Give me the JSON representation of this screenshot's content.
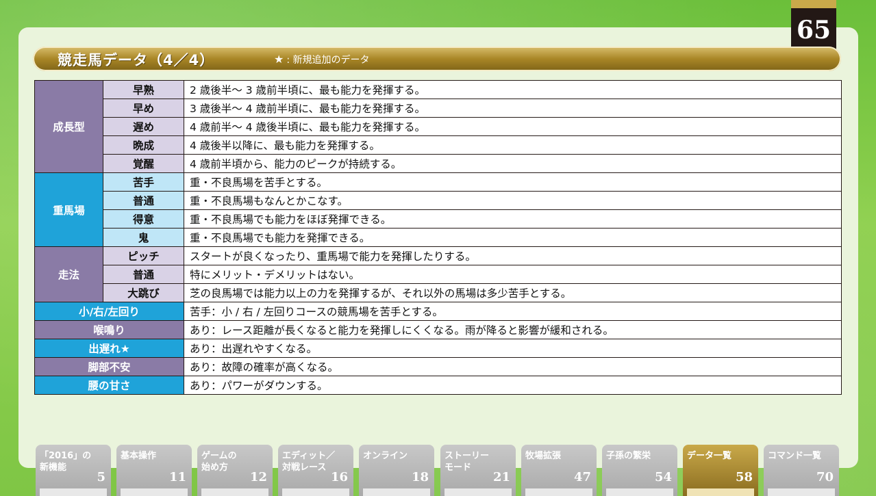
{
  "page_number": "65",
  "header": {
    "title": "競走馬データ（4／4）",
    "legend_mark": "★",
    "legend_text": ": 新規追加のデータ"
  },
  "table": {
    "groups": [
      {
        "category": "成長型",
        "color": "purple",
        "rows": [
          {
            "sub": "早熟",
            "desc": "2 歳後半〜 3 歳前半頃に、最も能力を発揮する。"
          },
          {
            "sub": "早め",
            "desc": "3 歳後半〜 4 歳前半頃に、最も能力を発揮する。"
          },
          {
            "sub": "遅め",
            "desc": "4 歳前半〜 4 歳後半頃に、最も能力を発揮する。"
          },
          {
            "sub": "晩成",
            "desc": "4 歳後半以降に、最も能力を発揮する。"
          },
          {
            "sub": "覚醒",
            "desc": "4 歳前半頃から、能力のピークが持続する。"
          }
        ]
      },
      {
        "category": "重馬場",
        "color": "cyan",
        "rows": [
          {
            "sub": "苦手",
            "desc": "重・不良馬場を苦手とする。"
          },
          {
            "sub": "普通",
            "desc": "重・不良馬場もなんとかこなす。"
          },
          {
            "sub": "得意",
            "desc": "重・不良馬場でも能力をほぼ発揮できる。"
          },
          {
            "sub": "鬼",
            "desc": "重・不良馬場でも能力を発揮できる。"
          }
        ]
      },
      {
        "category": "走法",
        "color": "purple",
        "rows": [
          {
            "sub": "ピッチ",
            "desc": "スタートが良くなったり、重馬場で能力を発揮したりする。"
          },
          {
            "sub": "普通",
            "desc": "特にメリット・デメリットはない。"
          },
          {
            "sub": "大跳び",
            "desc": "芝の良馬場では能力以上の力を発揮するが、それ以外の馬場は多少苦手とする。"
          }
        ]
      }
    ],
    "single_rows": [
      {
        "label": "小/右/左回り",
        "color": "cyan",
        "desc": "苦手：小 / 右 / 左回りコースの競馬場を苦手とする。"
      },
      {
        "label": "喉鳴り",
        "color": "purple",
        "desc": "あり：レース距離が長くなると能力を発揮しにくくなる。雨が降ると影響が緩和される。"
      },
      {
        "label": "出遅れ★",
        "color": "cyan",
        "desc": "あり：出遅れやすくなる。"
      },
      {
        "label": "脚部不安",
        "color": "purple",
        "desc": "あり：故障の確率が高くなる。"
      },
      {
        "label": "腰の甘さ",
        "color": "cyan",
        "desc": "あり：パワーがダウンする。"
      }
    ]
  },
  "nav_tabs": [
    {
      "label": "「2016」の\n新機能",
      "page": "5",
      "active": false
    },
    {
      "label": "基本操作",
      "page": "11",
      "active": false
    },
    {
      "label": "ゲームの\n始め方",
      "page": "12",
      "active": false
    },
    {
      "label": "エディット／\n対戦レース",
      "page": "16",
      "active": false
    },
    {
      "label": "オンライン",
      "page": "18",
      "active": false
    },
    {
      "label": "ストーリー\nモード",
      "page": "21",
      "active": false
    },
    {
      "label": "牧場拡張",
      "page": "47",
      "active": false
    },
    {
      "label": "子孫の繁栄",
      "page": "54",
      "active": false
    },
    {
      "label": "データ一覧",
      "page": "58",
      "active": true
    },
    {
      "label": "コマンド一覧",
      "page": "70",
      "active": false
    }
  ],
  "colors": {
    "purple": "#8a7ba6",
    "cyan": "#1fa3d9",
    "gold": "#a98626",
    "page_box": "#231815"
  }
}
